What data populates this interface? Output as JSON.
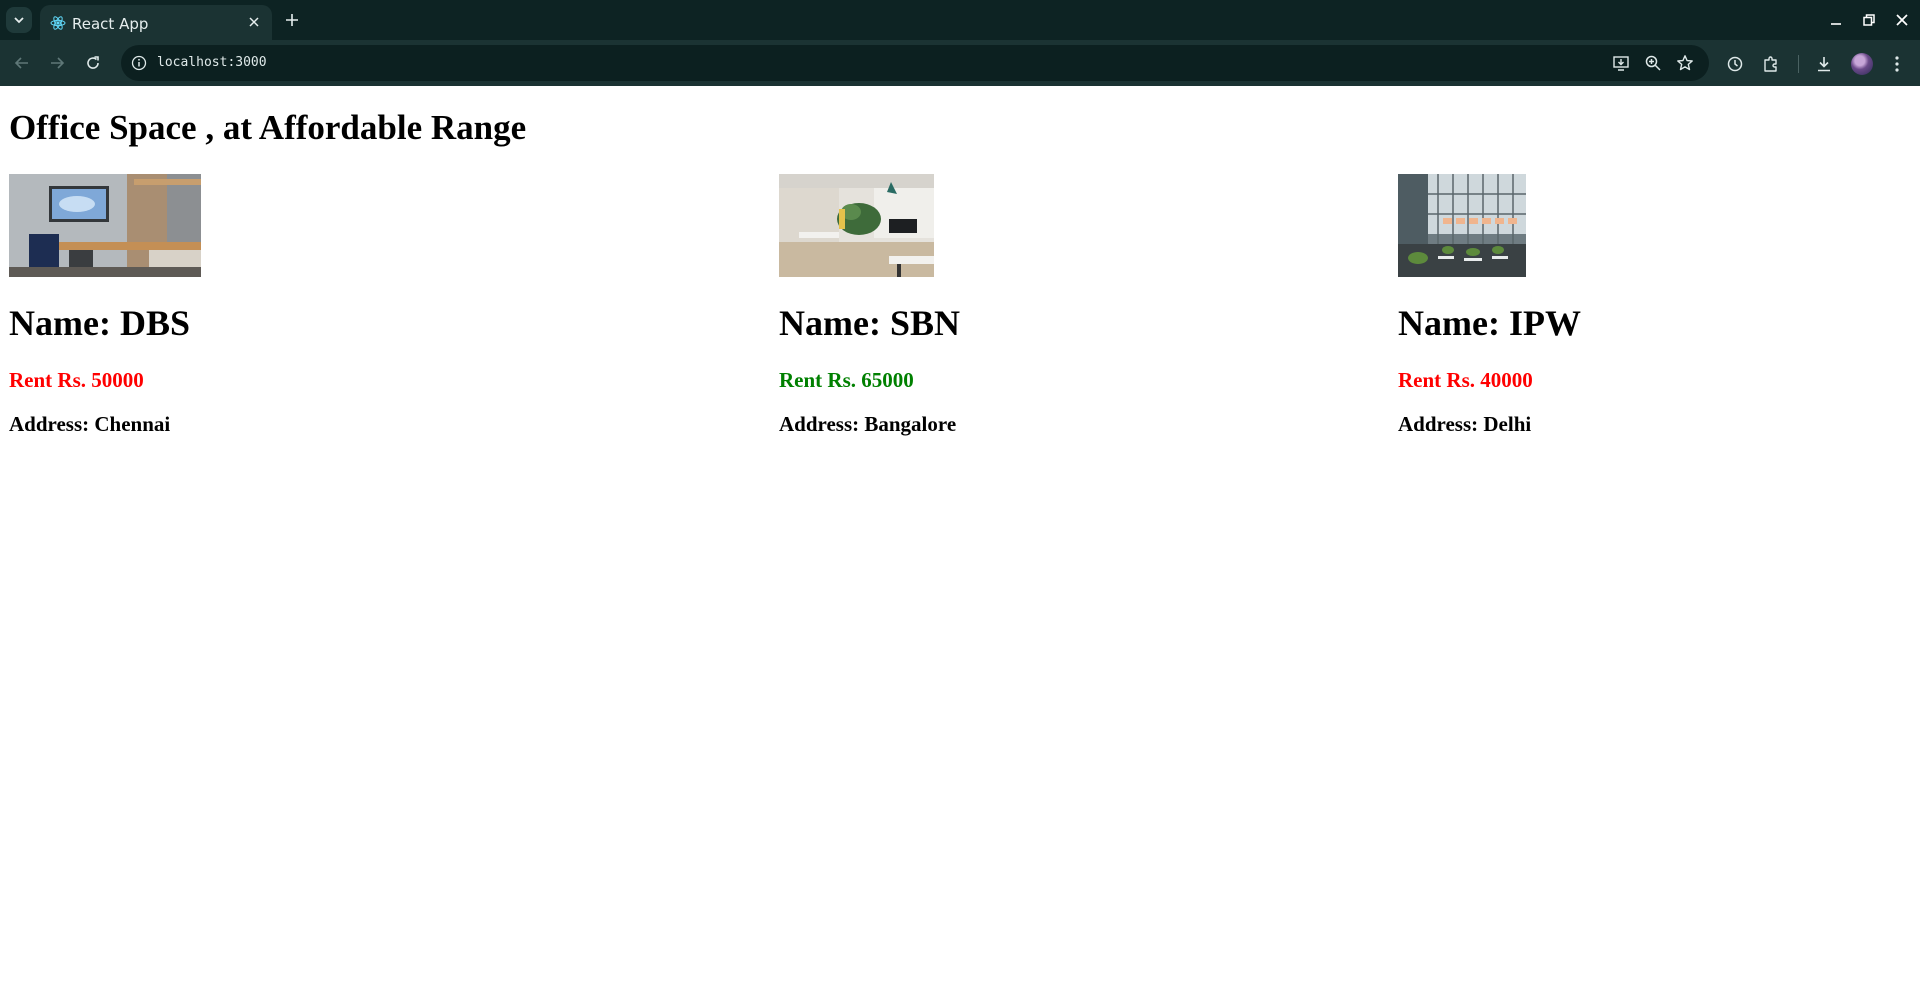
{
  "browser": {
    "tab_title": "React App",
    "url": "localhost:3000"
  },
  "page": {
    "title": "Office Space , at Affordable Range"
  },
  "offices": [
    {
      "name": "Name: DBS",
      "rent": "Rent Rs. 50000",
      "rent_color": "#ff0000",
      "address": "Address: Chennai"
    },
    {
      "name": "Name: SBN",
      "rent": "Rent Rs. 65000",
      "rent_color": "#008000",
      "address": "Address: Bangalore"
    },
    {
      "name": "Name: IPW",
      "rent": "Rent Rs. 40000",
      "rent_color": "#ff0000",
      "address": "Address: Delhi"
    }
  ],
  "colors": {
    "tabstrip": "#0d2323",
    "toolbar": "#1b3333",
    "rent_high": "#008000",
    "rent_low": "#ff0000"
  },
  "icons": [
    "tab-search-icon",
    "react-favicon-icon",
    "close-icon",
    "plus-icon",
    "minimize-icon",
    "restore-icon",
    "window-close-icon",
    "back-arrow-icon",
    "forward-arrow-icon",
    "reload-icon",
    "info-icon",
    "install-app-icon",
    "zoom-icon",
    "star-icon",
    "history-icon",
    "extensions-icon",
    "download-icon",
    "more-vert-icon"
  ]
}
